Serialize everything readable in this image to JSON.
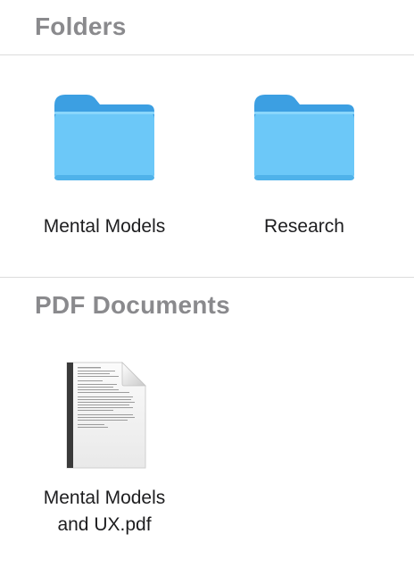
{
  "sections": [
    {
      "title": "Folders",
      "items": [
        {
          "label": "Mental Models",
          "icon": "folder-icon",
          "color": "#6cc8f8"
        },
        {
          "label": "Research",
          "icon": "folder-icon",
          "color": "#6cc8f8"
        }
      ]
    },
    {
      "title": "PDF Documents",
      "items": [
        {
          "label": "Mental Models\nand UX.pdf",
          "icon": "pdf-document-icon"
        }
      ]
    }
  ]
}
